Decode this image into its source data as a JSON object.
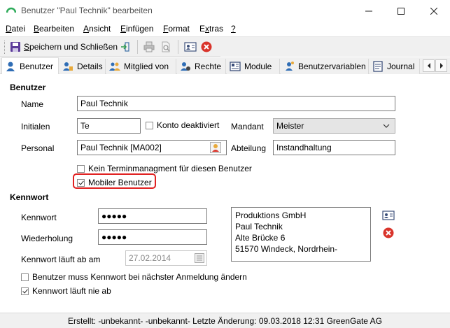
{
  "window": {
    "title": "Benutzer \"Paul Technik\" bearbeiten"
  },
  "menu": [
    {
      "label": "Datei",
      "mnemonic": "D",
      "rest": "atei"
    },
    {
      "label": "Bearbeiten",
      "mnemonic": "B",
      "rest": "earbeiten"
    },
    {
      "label": "Ansicht",
      "mnemonic": "A",
      "rest": "nsicht"
    },
    {
      "label": "Einfügen",
      "mnemonic": "E",
      "rest": "infügen"
    },
    {
      "label": "Format",
      "mnemonic": "F",
      "rest": "ormat"
    },
    {
      "label": "Extras",
      "mnemonic": "x",
      "pre": "E",
      "rest": "tras"
    },
    {
      "label": "?",
      "mnemonic": "?",
      "rest": ""
    }
  ],
  "toolbar": {
    "save_close_mnemonic": "S",
    "save_close_rest": "peichern und Schließen"
  },
  "tabs": [
    {
      "label": "Benutzer",
      "icon": "user-icon"
    },
    {
      "label": "Details",
      "icon": "user-details-icon"
    },
    {
      "label": "Mitglied von",
      "icon": "group-icon"
    },
    {
      "label": "Rechte",
      "icon": "rights-icon"
    },
    {
      "label": "Module",
      "icon": "module-icon"
    },
    {
      "label": "Benutzervariablen",
      "icon": "variables-icon"
    },
    {
      "label": "Journal",
      "icon": "journal-icon"
    }
  ],
  "benutzer": {
    "section_title": "Benutzer",
    "name_label": "Name",
    "name_value": "Paul Technik",
    "initialen_label": "Initialen",
    "initialen_value": "Te",
    "konto_deaktiviert_label": "Konto deaktiviert",
    "konto_deaktiviert_checked": false,
    "mandant_label": "Mandant",
    "mandant_value": "Meister",
    "personal_label": "Personal",
    "personal_value": "Paul Technik [MA002]",
    "abteilung_label": "Abteilung",
    "abteilung_value": "Instandhaltung",
    "kein_termin_label": "Kein Terminmanagment für diesen Benutzer",
    "kein_termin_checked": false,
    "mobiler_benutzer_label": "Mobiler Benutzer",
    "mobiler_benutzer_checked": true
  },
  "kennwort": {
    "section_title": "Kennwort",
    "kennwort_label": "Kennwort",
    "kennwort_value": "●●●●●",
    "wiederholung_label": "Wiederholung",
    "wiederholung_value": "●●●●●",
    "ablauf_label": "Kennwort läuft ab am",
    "ablauf_value": "27.02.2014",
    "muss_aendern_label": "Benutzer muss Kennwort bei nächster Anmeldung ändern",
    "muss_aendern_checked": false,
    "nie_ab_label": "Kennwort läuft nie ab",
    "nie_ab_checked": true
  },
  "address": {
    "lines": [
      "Produktions GmbH",
      "Paul Technik",
      "Alte Brücke 6",
      "51570 Windeck, Nordrhein-"
    ]
  },
  "status": {
    "text": "Erstellt: -unbekannt- -unbekannt-  Letzte Änderung: 09.03.2018 12:31 GreenGate AG"
  },
  "colors": {
    "highlight": "#e02020",
    "delete_red": "#d9342b",
    "app_green": "#2eab5a"
  }
}
